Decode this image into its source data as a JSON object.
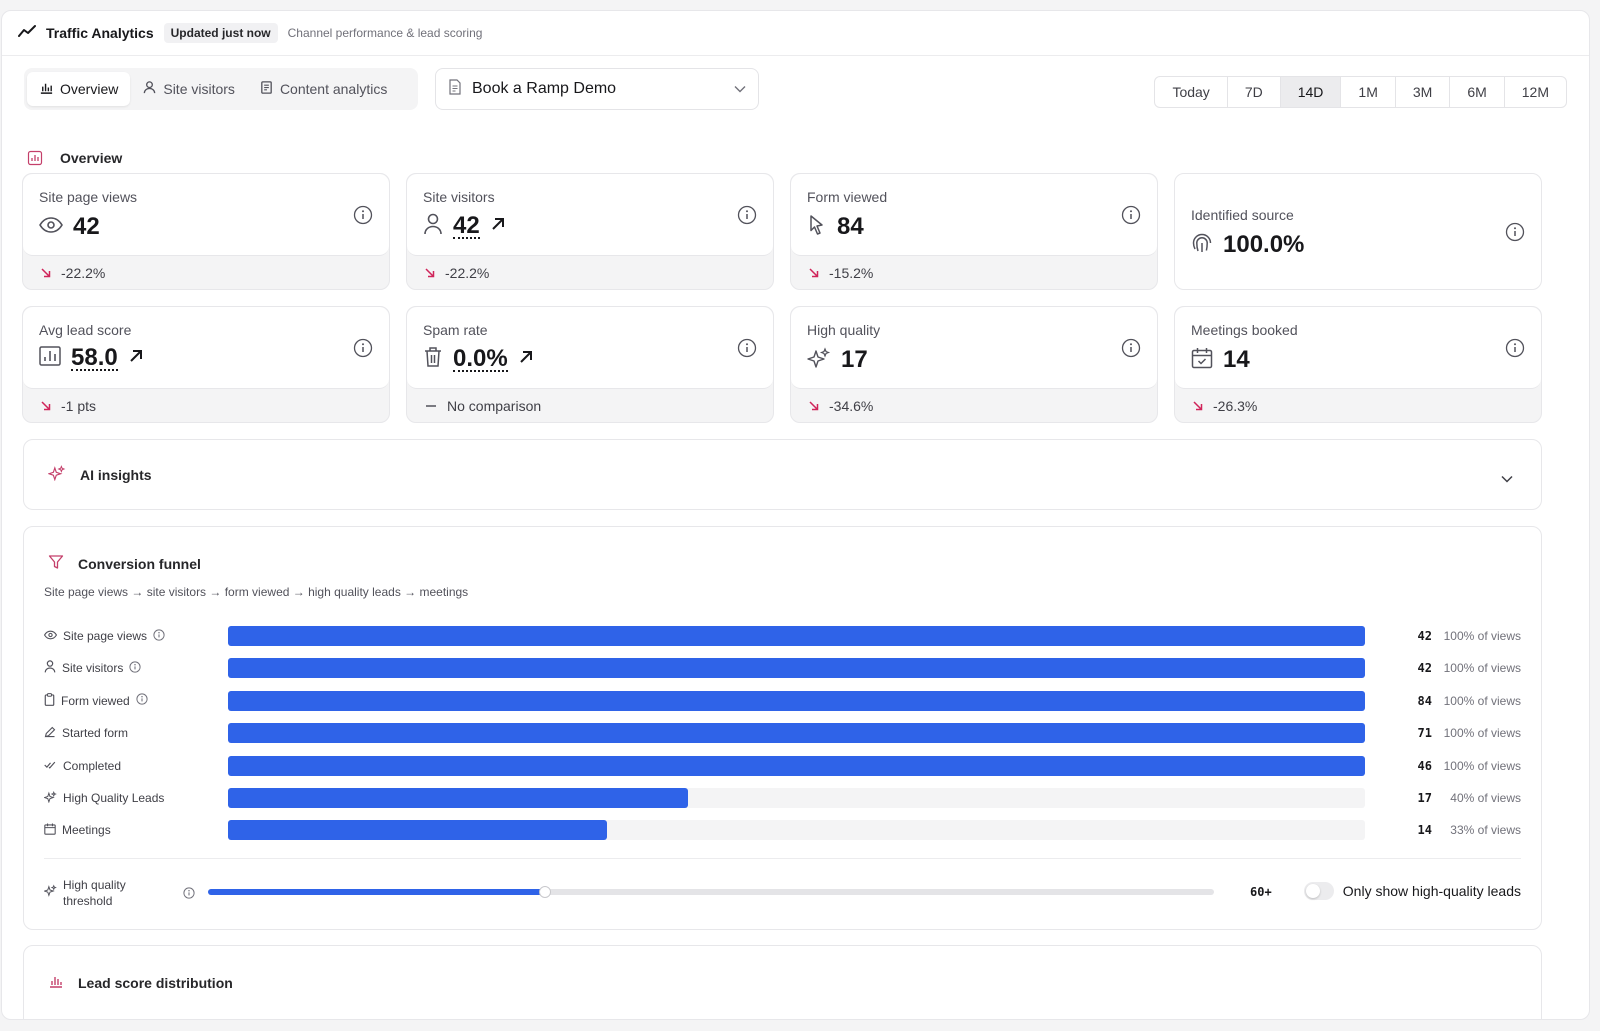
{
  "header": {
    "title": "Traffic Analytics",
    "badge": "Updated just now",
    "subtitle": "Channel performance & lead scoring"
  },
  "tabs": [
    {
      "label": "Overview",
      "icon": "bar-chart-icon",
      "active": true
    },
    {
      "label": "Site visitors",
      "icon": "user-icon",
      "active": false
    },
    {
      "label": "Content analytics",
      "icon": "document-icon",
      "active": false
    }
  ],
  "form_select": {
    "value": "Book a Ramp Demo"
  },
  "ranges": [
    {
      "label": "Today",
      "active": false
    },
    {
      "label": "7D",
      "active": false
    },
    {
      "label": "14D",
      "active": true
    },
    {
      "label": "1M",
      "active": false
    },
    {
      "label": "3M",
      "active": false
    },
    {
      "label": "6M",
      "active": false
    },
    {
      "label": "12M",
      "active": false
    }
  ],
  "overview_title": "Overview",
  "metrics": [
    {
      "label": "Site page views",
      "value": "42",
      "delta": "-22.2%",
      "icon": "eye-icon"
    },
    {
      "label": "Site visitors",
      "value": "42",
      "delta": "-22.2%",
      "icon": "user-icon"
    },
    {
      "label": "Form viewed",
      "value": "84",
      "delta": "-15.2%",
      "icon": "cursor-icon"
    },
    {
      "label": "Identified source",
      "value": "100.0%",
      "delta": "",
      "icon": "fingerprint-icon"
    },
    {
      "label": "Avg lead score",
      "value": "58.0",
      "delta": "-1 pts",
      "icon": "bar-chart-icon"
    },
    {
      "label": "Spam rate",
      "value": "0.0%",
      "delta": "No comparison",
      "icon": "trash-icon"
    },
    {
      "label": "High quality",
      "value": "17",
      "delta": "-34.6%",
      "icon": "sparkles-icon"
    },
    {
      "label": "Meetings booked",
      "value": "14",
      "delta": "-26.3%",
      "icon": "calendar-icon"
    }
  ],
  "ai_insights": {
    "title": "AI insights"
  },
  "funnel": {
    "title": "Conversion funnel",
    "subtitle": "Site page views → site visitors → form viewed → high quality leads → meetings",
    "rows": [
      {
        "label": "Site page views",
        "count": "42",
        "pct": "100% of views",
        "fill": 1.0,
        "icon": "eye-icon",
        "info": true
      },
      {
        "label": "Site visitors",
        "count": "42",
        "pct": "100% of views",
        "fill": 1.0,
        "icon": "user-icon",
        "info": true
      },
      {
        "label": "Form viewed",
        "count": "84",
        "pct": "100% of views",
        "fill": 1.0,
        "icon": "clipboard-icon",
        "info": true
      },
      {
        "label": "Started form",
        "count": "71",
        "pct": "100% of views",
        "fill": 1.0,
        "icon": "pencil-icon",
        "info": false
      },
      {
        "label": "Completed",
        "count": "46",
        "pct": "100% of views",
        "fill": 1.0,
        "icon": "double-check-icon",
        "info": false
      },
      {
        "label": "High Quality Leads",
        "count": "17",
        "pct": "40% of views",
        "fill": 0.405,
        "icon": "sparkles-icon",
        "info": false
      },
      {
        "label": "Meetings",
        "count": "14",
        "pct": "33% of views",
        "fill": 0.333,
        "icon": "calendar-icon",
        "info": false
      }
    ],
    "threshold": {
      "label_line1": "High quality",
      "label_line2": "threshold",
      "value": "60+",
      "fill": 0.335
    },
    "toggle_label": "Only show high-quality leads",
    "toggle_on": false
  },
  "lead_distribution": {
    "title": "Lead score distribution"
  },
  "colors": {
    "accent": "#2f63e8",
    "negative": "#d0245a",
    "icon_accent": "#c43f6a"
  }
}
